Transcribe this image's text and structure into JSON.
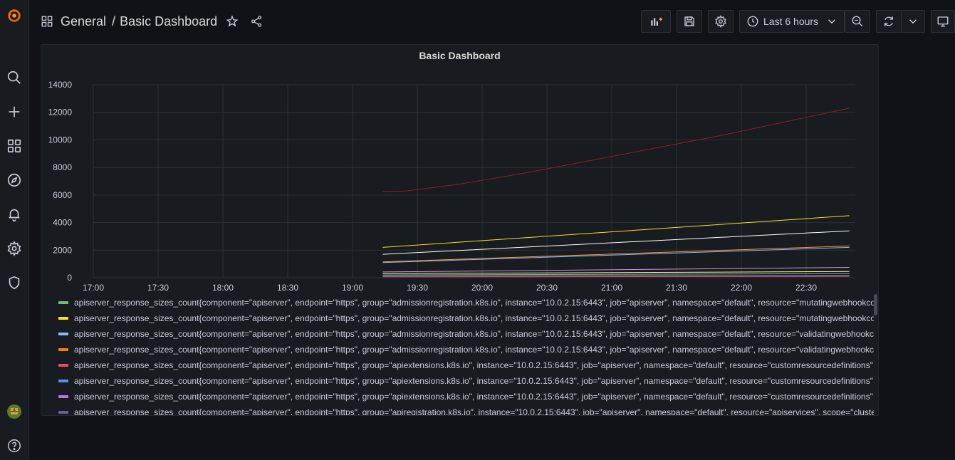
{
  "breadcrumb": {
    "folder": "General",
    "separator": "/",
    "dashboard": "Basic Dashboard"
  },
  "toolbar": {
    "time_range": "Last 6 hours"
  },
  "sidebar": {
    "items": [
      "grafana-logo-icon",
      "search-icon",
      "plus-icon",
      "dashboards-icon",
      "explore-icon",
      "alerting-icon",
      "settings-icon",
      "shield-icon",
      "user-avatar",
      "help-icon"
    ]
  },
  "panel": {
    "title": "Basic Dashboard"
  },
  "chart_data": {
    "type": "line",
    "title": "Basic Dashboard",
    "x_ticks": [
      "17:00",
      "17:30",
      "18:00",
      "18:30",
      "19:00",
      "19:30",
      "20:00",
      "20:30",
      "21:00",
      "21:30",
      "22:00",
      "22:30"
    ],
    "y_ticks": [
      "0",
      "2000",
      "4000",
      "6000",
      "8000",
      "10000",
      "12000",
      "14000"
    ],
    "ylim": [
      0,
      14000
    ],
    "x_range_minutes": [
      0,
      355
    ],
    "grid": true,
    "legend_placement": "bottom",
    "series": [
      {
        "color": "#8b1e2e",
        "x": [
          134,
          145,
          170,
          200,
          230,
          260,
          290,
          320,
          350
        ],
        "y": [
          6250,
          6300,
          6800,
          7600,
          8500,
          9400,
          10300,
          11300,
          12300
        ]
      },
      {
        "color": "#fade2a",
        "x": [
          134,
          350
        ],
        "y": [
          2200,
          4500
        ]
      },
      {
        "color": "#ffffff",
        "x": [
          134,
          350
        ],
        "y": [
          1700,
          3400
        ]
      },
      {
        "color": "#ff9830",
        "x": [
          134,
          350
        ],
        "y": [
          1150,
          2300
        ]
      },
      {
        "color": "#8ab8ff",
        "x": [
          134,
          350
        ],
        "y": [
          1100,
          2200
        ]
      },
      {
        "color": "#ca95e5",
        "x": [
          134,
          350
        ],
        "y": [
          420,
          750
        ]
      },
      {
        "color": "#fff899",
        "x": [
          134,
          350
        ],
        "y": [
          300,
          450
        ]
      },
      {
        "color": "#73bf69",
        "x": [
          134,
          350
        ],
        "y": [
          200,
          300
        ]
      },
      {
        "color": "#5794f2",
        "x": [
          134,
          350
        ],
        "y": [
          120,
          180
        ]
      },
      {
        "color": "#f2495c",
        "x": [
          134,
          350
        ],
        "y": [
          60,
          90
        ]
      }
    ]
  },
  "legend": [
    {
      "color": "#73bf69",
      "label": "apiserver_response_sizes_count{component=\"apiserver\", endpoint=\"https\", group=\"admissionregistration.k8s.io\", instance=\"10.0.2.15:6443\", job=\"apiserver\", namespace=\"default\", resource=\"mutatingwebhookconfigurations\""
    },
    {
      "color": "#fade2a",
      "label": "apiserver_response_sizes_count{component=\"apiserver\", endpoint=\"https\", group=\"admissionregistration.k8s.io\", instance=\"10.0.2.15:6443\", job=\"apiserver\", namespace=\"default\", resource=\"mutatingwebhookconfigurations\""
    },
    {
      "color": "#8ab8ff",
      "label": "apiserver_response_sizes_count{component=\"apiserver\", endpoint=\"https\", group=\"admissionregistration.k8s.io\", instance=\"10.0.2.15:6443\", job=\"apiserver\", namespace=\"default\", resource=\"validatingwebhookconfigurations\""
    },
    {
      "color": "#ff780a",
      "label": "apiserver_response_sizes_count{component=\"apiserver\", endpoint=\"https\", group=\"admissionregistration.k8s.io\", instance=\"10.0.2.15:6443\", job=\"apiserver\", namespace=\"default\", resource=\"validatingwebhookconfigurations\""
    },
    {
      "color": "#f2495c",
      "label": "apiserver_response_sizes_count{component=\"apiserver\", endpoint=\"https\", group=\"apiextensions.k8s.io\", instance=\"10.0.2.15:6443\", job=\"apiserver\", namespace=\"default\", resource=\"customresourcedefinitions\""
    },
    {
      "color": "#5794f2",
      "label": "apiserver_response_sizes_count{component=\"apiserver\", endpoint=\"https\", group=\"apiextensions.k8s.io\", instance=\"10.0.2.15:6443\", job=\"apiserver\", namespace=\"default\", resource=\"customresourcedefinitions\""
    },
    {
      "color": "#b877d9",
      "label": "apiserver_response_sizes_count{component=\"apiserver\", endpoint=\"https\", group=\"apiextensions.k8s.io\", instance=\"10.0.2.15:6443\", job=\"apiserver\", namespace=\"default\", resource=\"customresourcedefinitions\""
    },
    {
      "color": "#705da0",
      "label": "apiserver_response_sizes_count{component=\"apiserver\", endpoint=\"https\", group=\"apiregistration.k8s.io\", instance=\"10.0.2.15:6443\", job=\"apiserver\", namespace=\"default\", resource=\"apiservices\", scope=\"cluster\""
    }
  ]
}
